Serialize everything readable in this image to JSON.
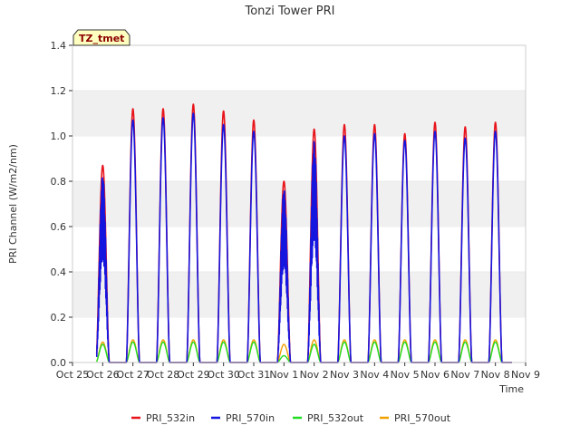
{
  "chart_data": {
    "type": "line",
    "title": "Tonzi Tower PRI",
    "xlabel": "Time",
    "ylabel": "PRI Channel (W/m2/nm)",
    "tag": "TZ_tmet",
    "ylim": [
      0,
      1.4
    ],
    "yticks": [
      "0.0",
      "0.2",
      "0.4",
      "0.6",
      "0.8",
      "1.0",
      "1.2",
      "1.4"
    ],
    "xlim": [
      0,
      15
    ],
    "xticks": [
      "Oct 25",
      "Oct 26",
      "Oct 27",
      "Oct 28",
      "Oct 29",
      "Oct 30",
      "Oct 31",
      "Nov 1",
      "Nov 2",
      "Nov 3",
      "Nov 4",
      "Nov 5",
      "Nov 6",
      "Nov 7",
      "Nov 8",
      "Nov 9"
    ],
    "grid": "horizontal bands",
    "legend_position": "bottom",
    "daily_peaks": {
      "days": [
        "Oct 26",
        "Oct 27",
        "Oct 28",
        "Oct 29",
        "Oct 30",
        "Oct 31",
        "Nov 1",
        "Nov 2",
        "Nov 3",
        "Nov 4",
        "Nov 5",
        "Nov 6",
        "Nov 7",
        "Nov 8"
      ],
      "day_index": [
        1,
        2,
        3,
        4,
        5,
        6,
        7,
        8,
        9,
        10,
        11,
        12,
        13,
        14
      ]
    },
    "series": [
      {
        "name": "PRI_532in",
        "color": "#e8141b",
        "peaks": [
          0.87,
          1.12,
          1.12,
          1.14,
          1.11,
          1.07,
          0.8,
          1.03,
          1.05,
          1.05,
          1.01,
          1.06,
          1.04,
          1.06
        ]
      },
      {
        "name": "PRI_570in",
        "color": "#1515e0",
        "peaks": [
          0.83,
          1.07,
          1.08,
          1.1,
          1.05,
          1.02,
          0.77,
          0.98,
          1.0,
          1.01,
          0.98,
          1.02,
          0.99,
          1.02
        ]
      },
      {
        "name": "PRI_532out",
        "color": "#22dd22",
        "peaks": [
          0.08,
          0.09,
          0.09,
          0.09,
          0.09,
          0.09,
          0.03,
          0.08,
          0.09,
          0.09,
          0.09,
          0.09,
          0.09,
          0.09
        ]
      },
      {
        "name": "PRI_570out",
        "color": "#f0a000",
        "peaks": [
          0.09,
          0.1,
          0.1,
          0.1,
          0.1,
          0.1,
          0.08,
          0.1,
          0.1,
          0.1,
          0.1,
          0.1,
          0.1,
          0.1
        ]
      }
    ]
  }
}
